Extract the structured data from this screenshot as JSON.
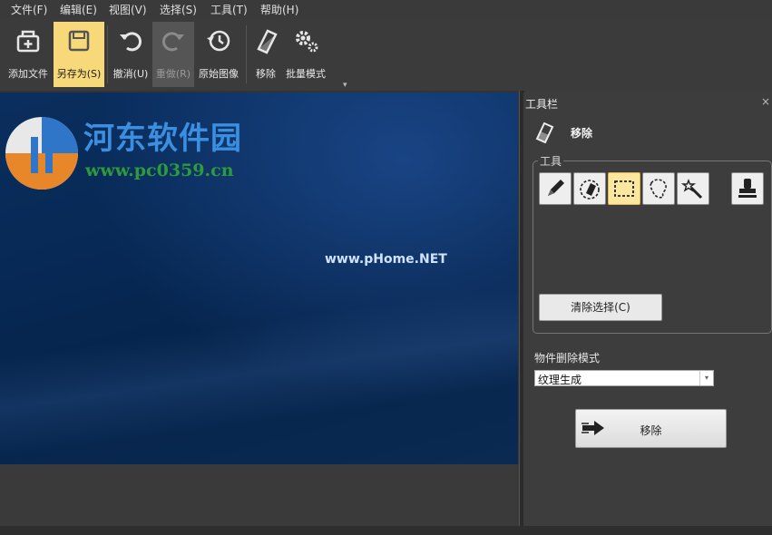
{
  "menu": {
    "items": [
      "文件(F)",
      "编辑(E)",
      "视图(V)",
      "选择(S)",
      "工具(T)",
      "帮助(H)"
    ]
  },
  "toolbar": {
    "add_file": "添加文件",
    "save_as": "另存为(S)",
    "undo": "撤消(U)",
    "redo": "重做(R)",
    "original_image": "原始图像",
    "remove": "移除",
    "batch_mode": "批量模式",
    "overflow": "▾"
  },
  "canvas": {
    "watermark_cn": "河东软件园",
    "watermark_url": "www.pc0359.cn",
    "watermark_phome": "www.pHome.NET"
  },
  "panel": {
    "title": "工具栏",
    "close": "×",
    "tool_name": "移除",
    "tools_group_label": "工具",
    "tools": [
      "pencil-icon",
      "eraser-circle-icon",
      "rect-select-icon",
      "lasso-icon",
      "magic-wand-icon",
      "stamp-icon"
    ],
    "active_tool": "rect-select-icon",
    "clear_selection": "清除选择(C)",
    "mode_label": "物件删除模式",
    "mode_value": "纹理生成",
    "remove_button": "移除"
  },
  "colors": {
    "highlight": "#f7d97a",
    "active_tool": "#fbe7a0",
    "background": "#3c3c3c"
  }
}
